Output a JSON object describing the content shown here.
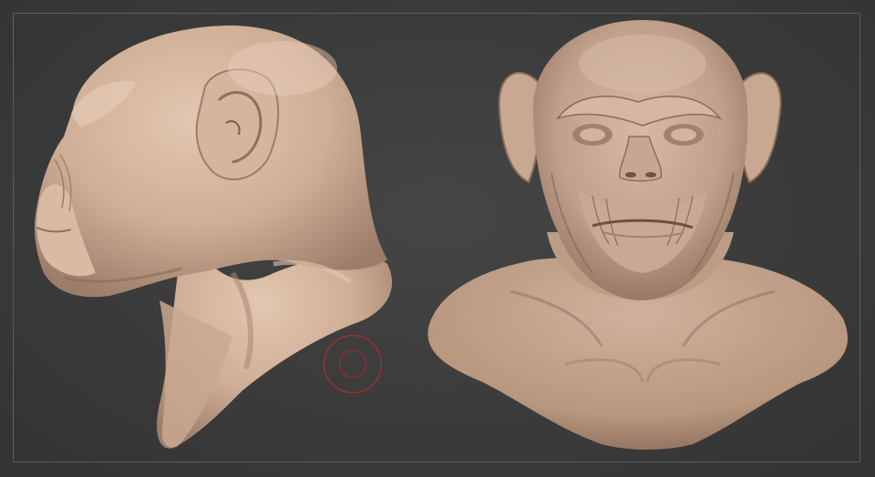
{
  "viewport": {
    "background": "#3a3a3a",
    "frame_color": "#5c5c5c"
  },
  "models": [
    {
      "name": "chimp-head-side-view",
      "skin": "#d2b49c"
    },
    {
      "name": "chimp-bust-front-view",
      "skin": "#c8a994"
    }
  ],
  "brush": {
    "icon": "brush-cursor-icon",
    "color": "#c8292c"
  }
}
